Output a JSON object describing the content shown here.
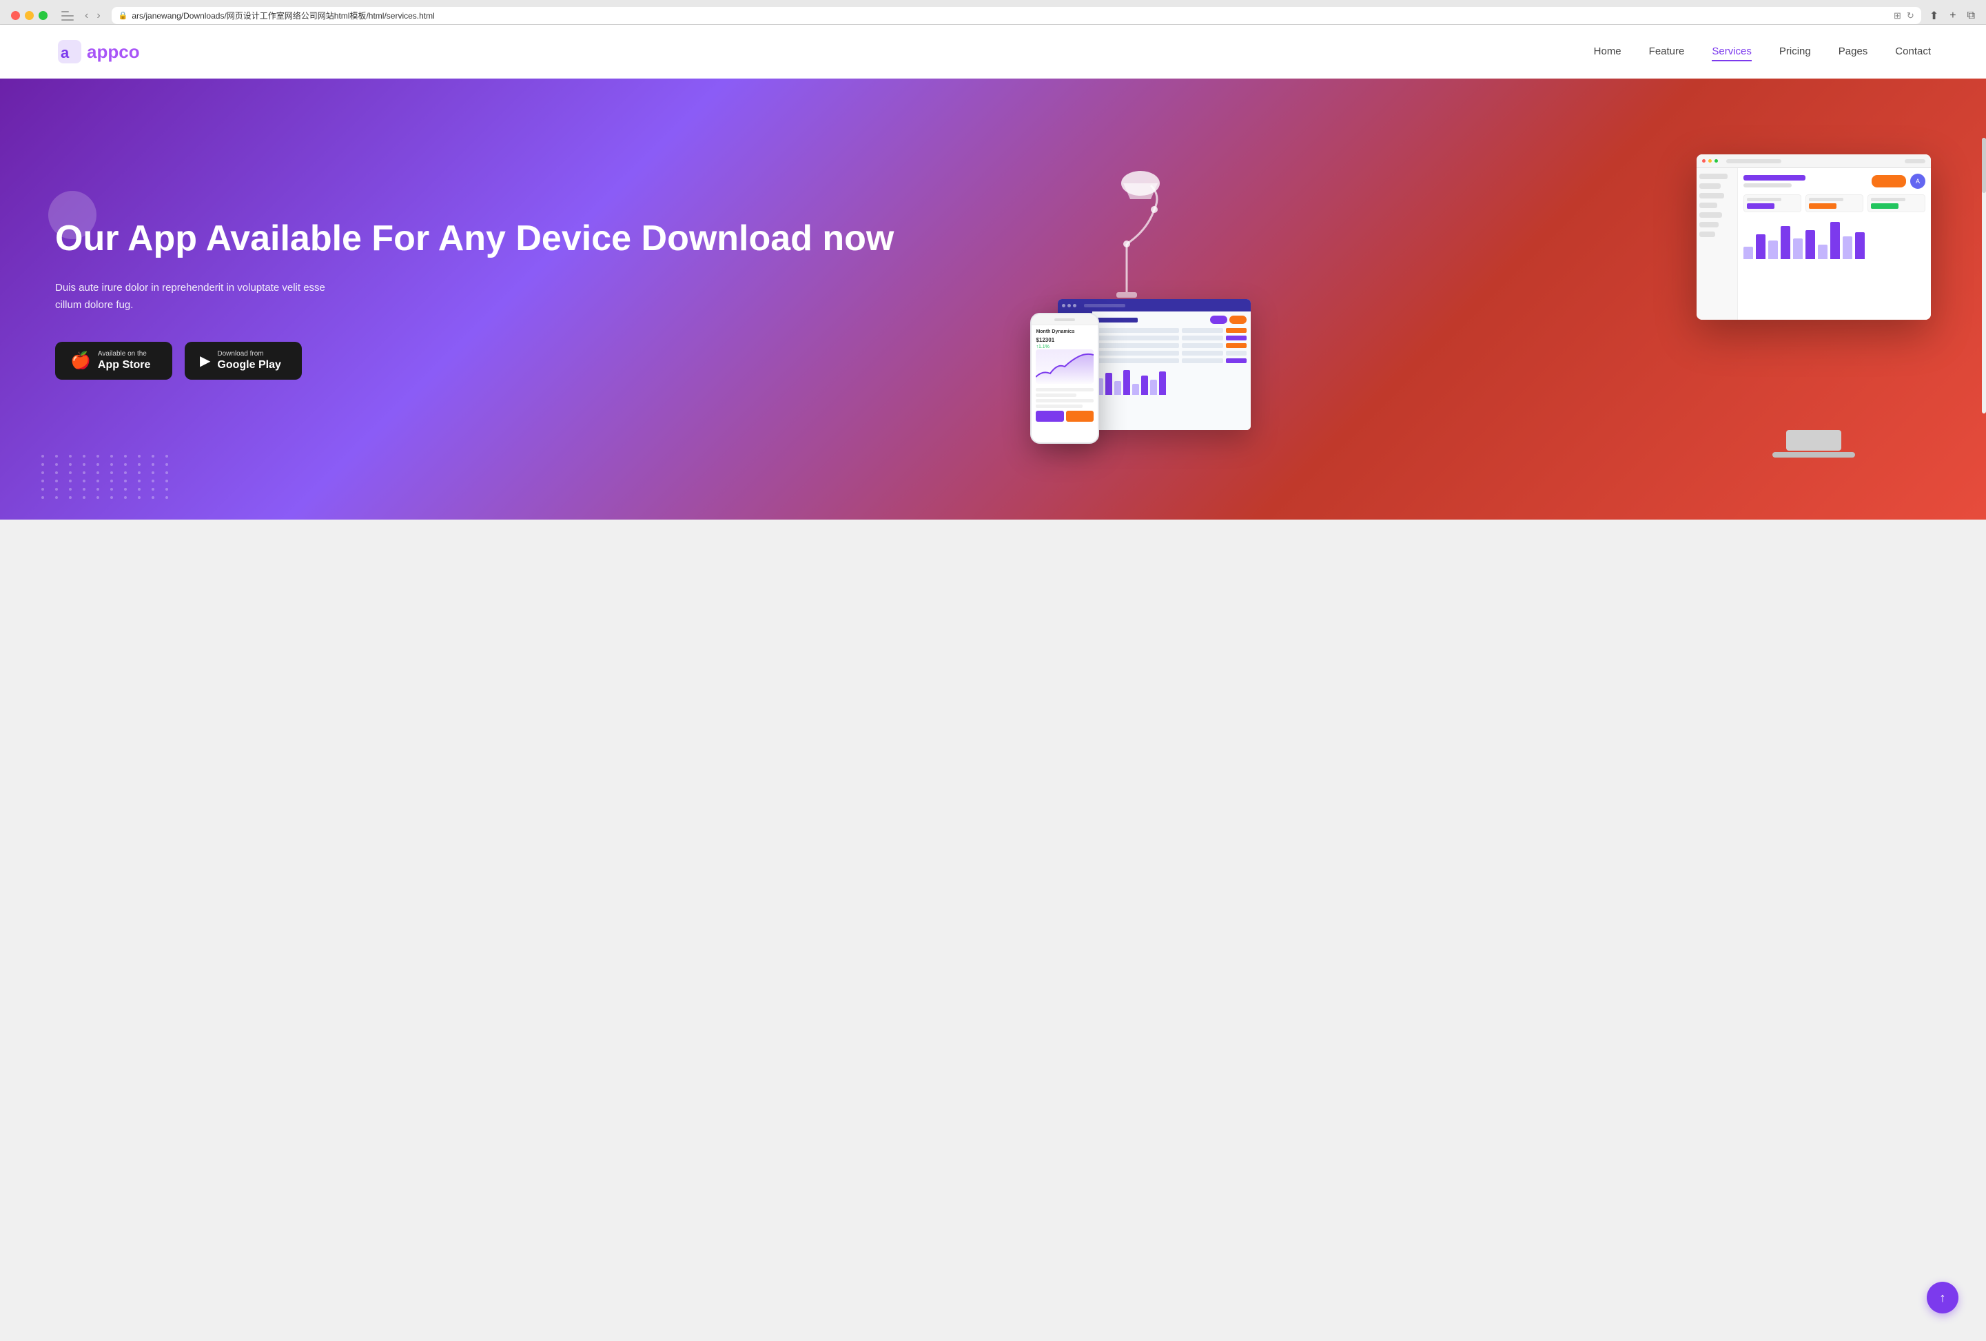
{
  "browser": {
    "address": "ars/janewang/Downloads/网页设计工作室网络公司网站html模板/html/services.html",
    "nav_back": "‹",
    "nav_forward": "›"
  },
  "header": {
    "logo_text_1": "app",
    "logo_text_2": "co",
    "nav_items": [
      {
        "id": "home",
        "label": "Home",
        "active": false
      },
      {
        "id": "feature",
        "label": "Feature",
        "active": false
      },
      {
        "id": "services",
        "label": "Services",
        "active": true
      },
      {
        "id": "pricing",
        "label": "Pricing",
        "active": false
      },
      {
        "id": "pages",
        "label": "Pages",
        "active": false
      },
      {
        "id": "contact",
        "label": "Contact",
        "active": false
      }
    ]
  },
  "hero": {
    "title": "Our App Available For Any Device Download now",
    "subtitle": "Duis aute irure dolor in reprehenderit in voluptate velit esse cillum dolore fug.",
    "app_store": {
      "label": "Available on the",
      "name": "App Store"
    },
    "google_play": {
      "label": "Download from",
      "name": "Google Play"
    }
  },
  "scroll_top_icon": "↑"
}
